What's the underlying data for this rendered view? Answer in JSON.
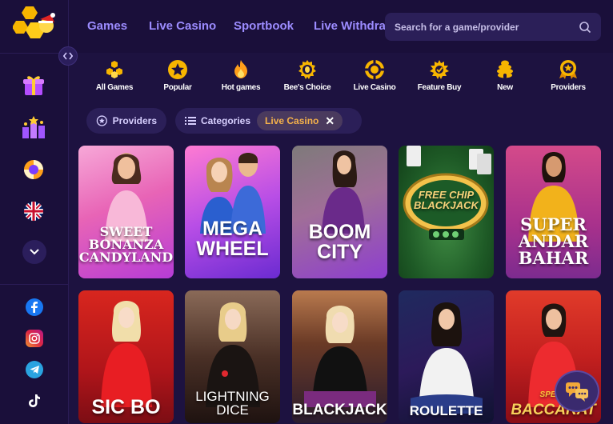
{
  "nav": {
    "links": [
      "Games",
      "Live Casino",
      "Sportbook",
      "Live Withdra"
    ],
    "search_placeholder": "Search for a game/provider"
  },
  "categories": [
    {
      "label": "All Games",
      "icon": "all-games-icon"
    },
    {
      "label": "Popular",
      "icon": "star-icon"
    },
    {
      "label": "Hot games",
      "icon": "flame-icon"
    },
    {
      "label": "Bee's Choice",
      "icon": "bee-icon"
    },
    {
      "label": "Live Casino",
      "icon": "poker-chip-icon"
    },
    {
      "label": "Feature Buy",
      "icon": "feature-buy-icon"
    },
    {
      "label": "New",
      "icon": "beehive-icon"
    },
    {
      "label": "Providers",
      "icon": "medal-icon"
    }
  ],
  "filters": {
    "providers_label": "Providers",
    "categories_label": "Categories",
    "active_chip": "Live Casino"
  },
  "games": [
    {
      "title": "SWEET\nBONANZA\nCANDYLAND"
    },
    {
      "title": "MEGA\nWHEEL"
    },
    {
      "title": "BOOM\nCITY"
    },
    {
      "title": "FREE CHIP\nBLACKJACK"
    },
    {
      "title": "SUPER\nANDAR\nBAHAR"
    },
    {
      "title": "SIC BO"
    },
    {
      "title": "LIGHTNING\nDICE"
    },
    {
      "title": "BLACKJACK"
    },
    {
      "title": "ROULETTE"
    },
    {
      "title": "BACCARAT",
      "subtitle": "SPEED"
    }
  ],
  "colors": {
    "background": "#1d1240",
    "sidebar": "#1a0f3a",
    "nav_link": "#9c8cff",
    "accent_orange": "#f5b14a"
  }
}
